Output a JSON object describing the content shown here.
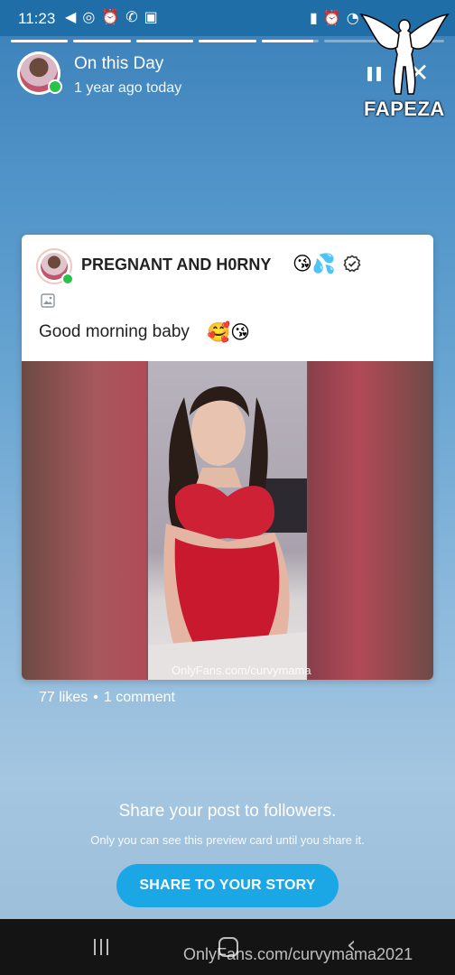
{
  "status_bar": {
    "time": "11:23",
    "left_icons": [
      "telegram-icon",
      "circle-app-icon",
      "alarm-icon",
      "phone-wave-icon",
      "gallery-icon"
    ],
    "right_icons": [
      "battery-saver-icon",
      "alarm-icon",
      "wifi-icon"
    ]
  },
  "progress": {
    "segments": [
      1,
      1,
      1,
      1,
      0.9,
      0,
      0
    ]
  },
  "header": {
    "title": "On this Day",
    "subtitle": "1 year ago today"
  },
  "watermark": {
    "logo_text": "FAPEZA",
    "footer_text": "OnlyFans.com/curvymama2021"
  },
  "card": {
    "author_name": "PREGNANT AND H0RNY",
    "name_emoji": "😘💦",
    "post_text": "Good morning baby",
    "post_emoji": "🥰😘",
    "photo_watermark": "OnlyFans.com/curvymama"
  },
  "stats": {
    "likes": "77 likes",
    "separator": "•",
    "comments": "1 comment"
  },
  "share": {
    "title": "Share your post to followers.",
    "subtitle": "Only you can see this preview card until you share it.",
    "button_label": "SHARE TO YOUR STORY"
  },
  "colors": {
    "accent": "#1ba7e6",
    "online": "#2bc24a",
    "status_bar": "#1f6ea8",
    "navbar": "#141414"
  }
}
